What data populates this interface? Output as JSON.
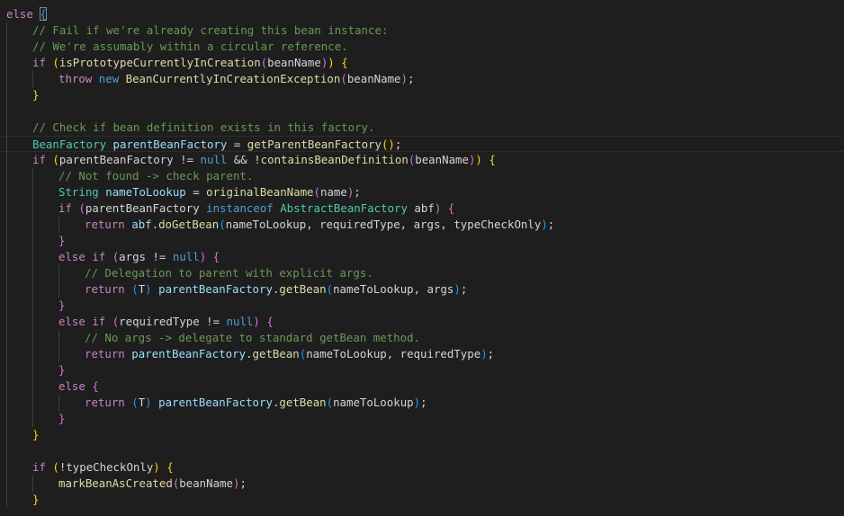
{
  "editor": {
    "theme": "dark",
    "background": "#1e1e1e",
    "token_colors": {
      "keyword_control": "#c586c0",
      "keyword": "#569cd6",
      "function": "#dcdcaa",
      "type": "#4ec9b0",
      "variable": "#9cdcfe",
      "comment": "#6a9955",
      "plain": "#d4d4d4",
      "bracket_level_1": "#ffd700",
      "bracket_level_2": "#da70d6",
      "bracket_level_3": "#179fff"
    },
    "current_line": 9,
    "lines": [
      {
        "indent": 0,
        "tokens": [
          [
            "kw",
            "else"
          ],
          [
            "pl",
            " "
          ],
          [
            "b3 cursor-brace",
            "{"
          ]
        ]
      },
      {
        "indent": 1,
        "tokens": [
          [
            "cm",
            "// Fail if we're already creating this bean instance:"
          ]
        ]
      },
      {
        "indent": 1,
        "tokens": [
          [
            "cm",
            "// We're assumably within a circular reference."
          ]
        ]
      },
      {
        "indent": 1,
        "tokens": [
          [
            "kw",
            "if"
          ],
          [
            "pl",
            " "
          ],
          [
            "b1",
            "("
          ],
          [
            "fn",
            "isPrototypeCurrentlyInCreation"
          ],
          [
            "b2",
            "("
          ],
          [
            "pl",
            "beanName"
          ],
          [
            "b2",
            ")"
          ],
          [
            "b1",
            ")"
          ],
          [
            "pl",
            " "
          ],
          [
            "b1",
            "{"
          ]
        ]
      },
      {
        "indent": 2,
        "tokens": [
          [
            "kw",
            "throw"
          ],
          [
            "pl",
            " "
          ],
          [
            "kw2",
            "new"
          ],
          [
            "pl",
            " "
          ],
          [
            "fn",
            "BeanCurrentlyInCreationException"
          ],
          [
            "b2",
            "("
          ],
          [
            "pl",
            "beanName"
          ],
          [
            "b2",
            ")"
          ],
          [
            "pl",
            ";"
          ]
        ]
      },
      {
        "indent": 1,
        "tokens": [
          [
            "b1",
            "}"
          ]
        ]
      },
      {
        "indent": 0,
        "tokens": []
      },
      {
        "indent": 1,
        "tokens": [
          [
            "cm",
            "// Check if bean definition exists in this factory."
          ]
        ]
      },
      {
        "indent": 1,
        "tokens": [
          [
            "ty",
            "BeanFactory"
          ],
          [
            "pl",
            " "
          ],
          [
            "var",
            "parentBeanFactory"
          ],
          [
            "pl",
            " = "
          ],
          [
            "fn",
            "getParentBeanFactory"
          ],
          [
            "b1",
            "()"
          ],
          [
            "pl",
            ";"
          ]
        ]
      },
      {
        "indent": 1,
        "tokens": [
          [
            "kw",
            "if"
          ],
          [
            "pl",
            " "
          ],
          [
            "b1",
            "("
          ],
          [
            "pl",
            "parentBeanFactory != "
          ],
          [
            "kw2",
            "null"
          ],
          [
            "pl",
            " && !"
          ],
          [
            "fn",
            "containsBeanDefinition"
          ],
          [
            "b2",
            "("
          ],
          [
            "pl",
            "beanName"
          ],
          [
            "b2",
            ")"
          ],
          [
            "b1",
            ")"
          ],
          [
            "pl",
            " "
          ],
          [
            "b1",
            "{"
          ]
        ]
      },
      {
        "indent": 2,
        "tokens": [
          [
            "cm",
            "// Not found -> check parent."
          ]
        ]
      },
      {
        "indent": 2,
        "tokens": [
          [
            "ty",
            "String"
          ],
          [
            "pl",
            " "
          ],
          [
            "var",
            "nameToLookup"
          ],
          [
            "pl",
            " = "
          ],
          [
            "fn",
            "originalBeanName"
          ],
          [
            "b2",
            "("
          ],
          [
            "pl",
            "name"
          ],
          [
            "b2",
            ")"
          ],
          [
            "pl",
            ";"
          ]
        ]
      },
      {
        "indent": 2,
        "tokens": [
          [
            "kw",
            "if"
          ],
          [
            "pl",
            " "
          ],
          [
            "b2",
            "("
          ],
          [
            "pl",
            "parentBeanFactory "
          ],
          [
            "kw2",
            "instanceof"
          ],
          [
            "pl",
            " "
          ],
          [
            "ty",
            "AbstractBeanFactory"
          ],
          [
            "pl",
            " abf"
          ],
          [
            "b2",
            ")"
          ],
          [
            "pl",
            " "
          ],
          [
            "b2",
            "{"
          ]
        ]
      },
      {
        "indent": 3,
        "tokens": [
          [
            "kw",
            "return"
          ],
          [
            "pl",
            " "
          ],
          [
            "var",
            "abf"
          ],
          [
            "pl",
            "."
          ],
          [
            "fn",
            "doGetBean"
          ],
          [
            "b3",
            "("
          ],
          [
            "pl",
            "nameToLookup, requiredType, args, typeCheckOnly"
          ],
          [
            "b3",
            ")"
          ],
          [
            "pl",
            ";"
          ]
        ]
      },
      {
        "indent": 2,
        "tokens": [
          [
            "b2",
            "}"
          ]
        ]
      },
      {
        "indent": 2,
        "tokens": [
          [
            "kw",
            "else"
          ],
          [
            "pl",
            " "
          ],
          [
            "kw",
            "if"
          ],
          [
            "pl",
            " "
          ],
          [
            "b2",
            "("
          ],
          [
            "pl",
            "args != "
          ],
          [
            "kw2",
            "null"
          ],
          [
            "b2",
            ")"
          ],
          [
            "pl",
            " "
          ],
          [
            "b2",
            "{"
          ]
        ]
      },
      {
        "indent": 3,
        "tokens": [
          [
            "cm",
            "// Delegation to parent with explicit args."
          ]
        ]
      },
      {
        "indent": 3,
        "tokens": [
          [
            "kw",
            "return"
          ],
          [
            "pl",
            " "
          ],
          [
            "b3",
            "("
          ],
          [
            "pl",
            "T"
          ],
          [
            "b3",
            ")"
          ],
          [
            "pl",
            " "
          ],
          [
            "var",
            "parentBeanFactory"
          ],
          [
            "pl",
            "."
          ],
          [
            "fn",
            "getBean"
          ],
          [
            "b3",
            "("
          ],
          [
            "pl",
            "nameToLookup, args"
          ],
          [
            "b3",
            ")"
          ],
          [
            "pl",
            ";"
          ]
        ]
      },
      {
        "indent": 2,
        "tokens": [
          [
            "b2",
            "}"
          ]
        ]
      },
      {
        "indent": 2,
        "tokens": [
          [
            "kw",
            "else"
          ],
          [
            "pl",
            " "
          ],
          [
            "kw",
            "if"
          ],
          [
            "pl",
            " "
          ],
          [
            "b2",
            "("
          ],
          [
            "pl",
            "requiredType != "
          ],
          [
            "kw2",
            "null"
          ],
          [
            "b2",
            ")"
          ],
          [
            "pl",
            " "
          ],
          [
            "b2",
            "{"
          ]
        ]
      },
      {
        "indent": 3,
        "tokens": [
          [
            "cm",
            "// No args -> delegate to standard getBean method."
          ]
        ]
      },
      {
        "indent": 3,
        "tokens": [
          [
            "kw",
            "return"
          ],
          [
            "pl",
            " "
          ],
          [
            "var",
            "parentBeanFactory"
          ],
          [
            "pl",
            "."
          ],
          [
            "fn",
            "getBean"
          ],
          [
            "b3",
            "("
          ],
          [
            "pl",
            "nameToLookup, requiredType"
          ],
          [
            "b3",
            ")"
          ],
          [
            "pl",
            ";"
          ]
        ]
      },
      {
        "indent": 2,
        "tokens": [
          [
            "b2",
            "}"
          ]
        ]
      },
      {
        "indent": 2,
        "tokens": [
          [
            "kw",
            "else"
          ],
          [
            "pl",
            " "
          ],
          [
            "b2",
            "{"
          ]
        ]
      },
      {
        "indent": 3,
        "tokens": [
          [
            "kw",
            "return"
          ],
          [
            "pl",
            " "
          ],
          [
            "b3",
            "("
          ],
          [
            "pl",
            "T"
          ],
          [
            "b3",
            ")"
          ],
          [
            "pl",
            " "
          ],
          [
            "var",
            "parentBeanFactory"
          ],
          [
            "pl",
            "."
          ],
          [
            "fn",
            "getBean"
          ],
          [
            "b3",
            "("
          ],
          [
            "pl",
            "nameToLookup"
          ],
          [
            "b3",
            ")"
          ],
          [
            "pl",
            ";"
          ]
        ]
      },
      {
        "indent": 2,
        "tokens": [
          [
            "b2",
            "}"
          ]
        ]
      },
      {
        "indent": 1,
        "tokens": [
          [
            "b1",
            "}"
          ]
        ]
      },
      {
        "indent": 0,
        "tokens": []
      },
      {
        "indent": 1,
        "tokens": [
          [
            "kw",
            "if"
          ],
          [
            "pl",
            " "
          ],
          [
            "b1",
            "("
          ],
          [
            "pl",
            "!typeCheckOnly"
          ],
          [
            "b1",
            ")"
          ],
          [
            "pl",
            " "
          ],
          [
            "b1",
            "{"
          ]
        ]
      },
      {
        "indent": 2,
        "tokens": [
          [
            "fn",
            "markBeanAsCreated"
          ],
          [
            "b2",
            "("
          ],
          [
            "pl",
            "beanName"
          ],
          [
            "b2",
            ")"
          ],
          [
            "pl",
            ";"
          ]
        ]
      },
      {
        "indent": 1,
        "tokens": [
          [
            "b1",
            "}"
          ]
        ]
      }
    ]
  }
}
